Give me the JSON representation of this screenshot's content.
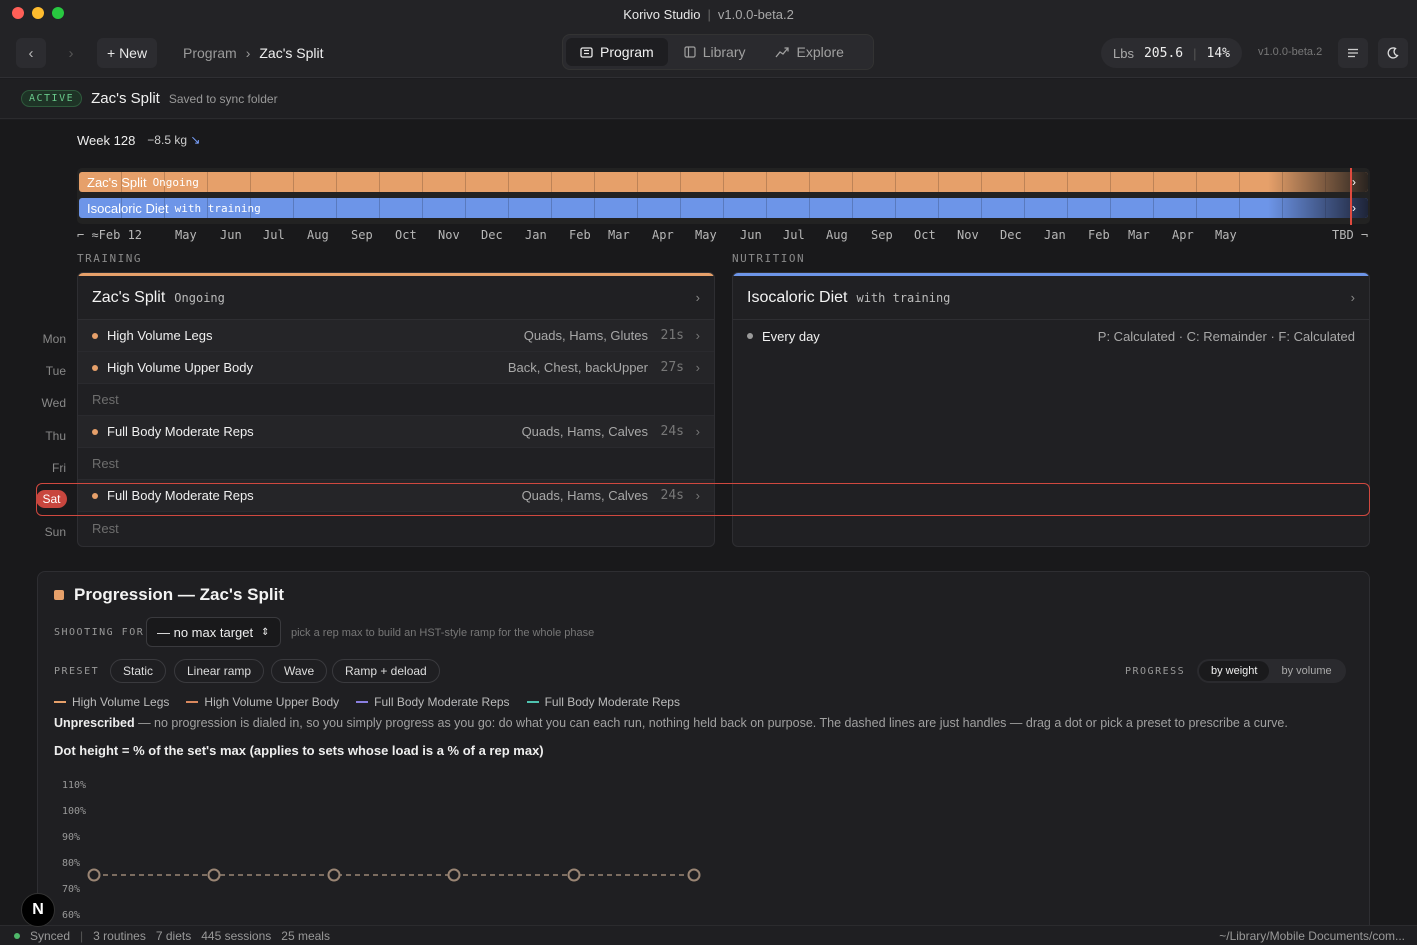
{
  "window": {
    "title": "Korivo Studio",
    "version": "v1.0.0-beta.2"
  },
  "toolbar": {
    "back_icon": "chevron-left-icon",
    "forward_icon": "chevron-right-icon",
    "new_label": "+ New",
    "breadcrumb": [
      "Program",
      "Zac's Split"
    ],
    "tabs": [
      {
        "label": "Program",
        "icon": "program-icon",
        "active": true
      },
      {
        "label": "Library",
        "icon": "library-icon",
        "active": false
      },
      {
        "label": "Explore",
        "icon": "explore-icon",
        "active": false
      }
    ],
    "weight_unit": "Lbs",
    "weight_value": "205.6",
    "bodyfat": "14%",
    "version_label": "v1.0.0-beta.2",
    "menu_icon": "menu-icon",
    "theme_icon": "moon-icon"
  },
  "active_bar": {
    "badge": "ACTIVE",
    "name": "Zac's Split",
    "status": "Saved to sync folder"
  },
  "week": {
    "label": "Week 128",
    "delta": "−8.5 kg",
    "delta_arrow": "↘"
  },
  "timeline": {
    "bars": [
      {
        "name": "Zac's Split",
        "kind": "Ongoing",
        "color": "#e6a06a"
      },
      {
        "name": "Isocaloric Diet",
        "kind": "with training",
        "color": "#6d95e8"
      }
    ],
    "months": [
      "⌐ ≈Feb 12",
      "May",
      "Jun",
      "Jul",
      "Aug",
      "Sep",
      "Oct",
      "Nov",
      "Dec",
      "Jan",
      "Feb",
      "Mar",
      "Apr",
      "May",
      "Jun",
      "Jul",
      "Aug",
      "Sep",
      "Oct",
      "Nov",
      "Dec",
      "Jan",
      "Feb",
      "Mar",
      "Apr",
      "May",
      "TBD ¬"
    ]
  },
  "training": {
    "section_label": "TRAINING",
    "card_title": "Zac's Split",
    "card_kind": "Ongoing",
    "accent": "#e6a06a",
    "days": [
      {
        "day": "Mon",
        "name": "High Volume Legs",
        "muscles": "Quads, Hams, Glutes",
        "dur": "21s",
        "rest": false
      },
      {
        "day": "Tue",
        "name": "High Volume Upper Body",
        "muscles": "Back, Chest, backUpper",
        "dur": "27s",
        "rest": false
      },
      {
        "day": "Wed",
        "name": "Rest",
        "rest": true
      },
      {
        "day": "Thu",
        "name": "Full Body Moderate Reps",
        "muscles": "Quads, Hams, Calves",
        "dur": "24s",
        "rest": false
      },
      {
        "day": "Fri",
        "name": "Rest",
        "rest": true
      },
      {
        "day": "Sat",
        "name": "Full Body Moderate Reps",
        "muscles": "Quads, Hams, Calves",
        "dur": "24s",
        "rest": false,
        "today": true
      },
      {
        "day": "Sun",
        "name": "Rest",
        "rest": true
      }
    ]
  },
  "nutrition": {
    "section_label": "NUTRITION",
    "card_title": "Isocaloric Diet",
    "card_kind": "with training",
    "accent": "#6d95e8",
    "row_label": "Every day",
    "row_detail": "P: Calculated · C: Remainder · F: Calculated"
  },
  "progression": {
    "title": "Progression — Zac's Split",
    "shooting_label": "SHOOTING FOR",
    "shooting_value": "— no max target",
    "hint": "pick a rep max to build an HST-style ramp for the whole phase",
    "preset_label": "PRESET",
    "presets": [
      "Static",
      "Linear ramp",
      "Wave",
      "Ramp + deload"
    ],
    "progress_label": "PROGRESS",
    "progress_options": [
      "by weight",
      "by volume"
    ],
    "legend": [
      {
        "name": "High Volume Legs",
        "color": "#e6a06a"
      },
      {
        "name": "High Volume Upper Body",
        "color": "#d9885e"
      },
      {
        "name": "Full Body Moderate Reps",
        "color": "#8a7fe0"
      },
      {
        "name": "Full Body Moderate Reps",
        "color": "#4fc3b0"
      }
    ],
    "unprescribed_title": "Unprescribed",
    "unprescribed_text": " — no progression is dialed in, so you simply progress as you go: do what you can each run, nothing held back on purpose. The dashed lines are just handles — drag a dot or pick a preset to prescribe a curve.",
    "dot_height_label": "Dot height = % of the set's max (applies to sets whose load is a % of a rep max)"
  },
  "chart_data": {
    "type": "line",
    "y_ticks": [
      "110%",
      "100%",
      "90%",
      "80%",
      "70%",
      "60%"
    ],
    "ylim": [
      60,
      110
    ],
    "x": [
      1,
      2,
      3,
      4,
      5,
      6
    ],
    "series": [
      {
        "values": [
          75,
          75,
          75,
          75,
          75,
          75
        ]
      }
    ]
  },
  "statusbar": {
    "sync": "Synced",
    "routines": "3 routines",
    "diets": "7 diets",
    "sessions": "445 sessions",
    "meals": "25 meals",
    "path": "~/Library/Mobile Documents/com..."
  },
  "badge_letter": "N"
}
